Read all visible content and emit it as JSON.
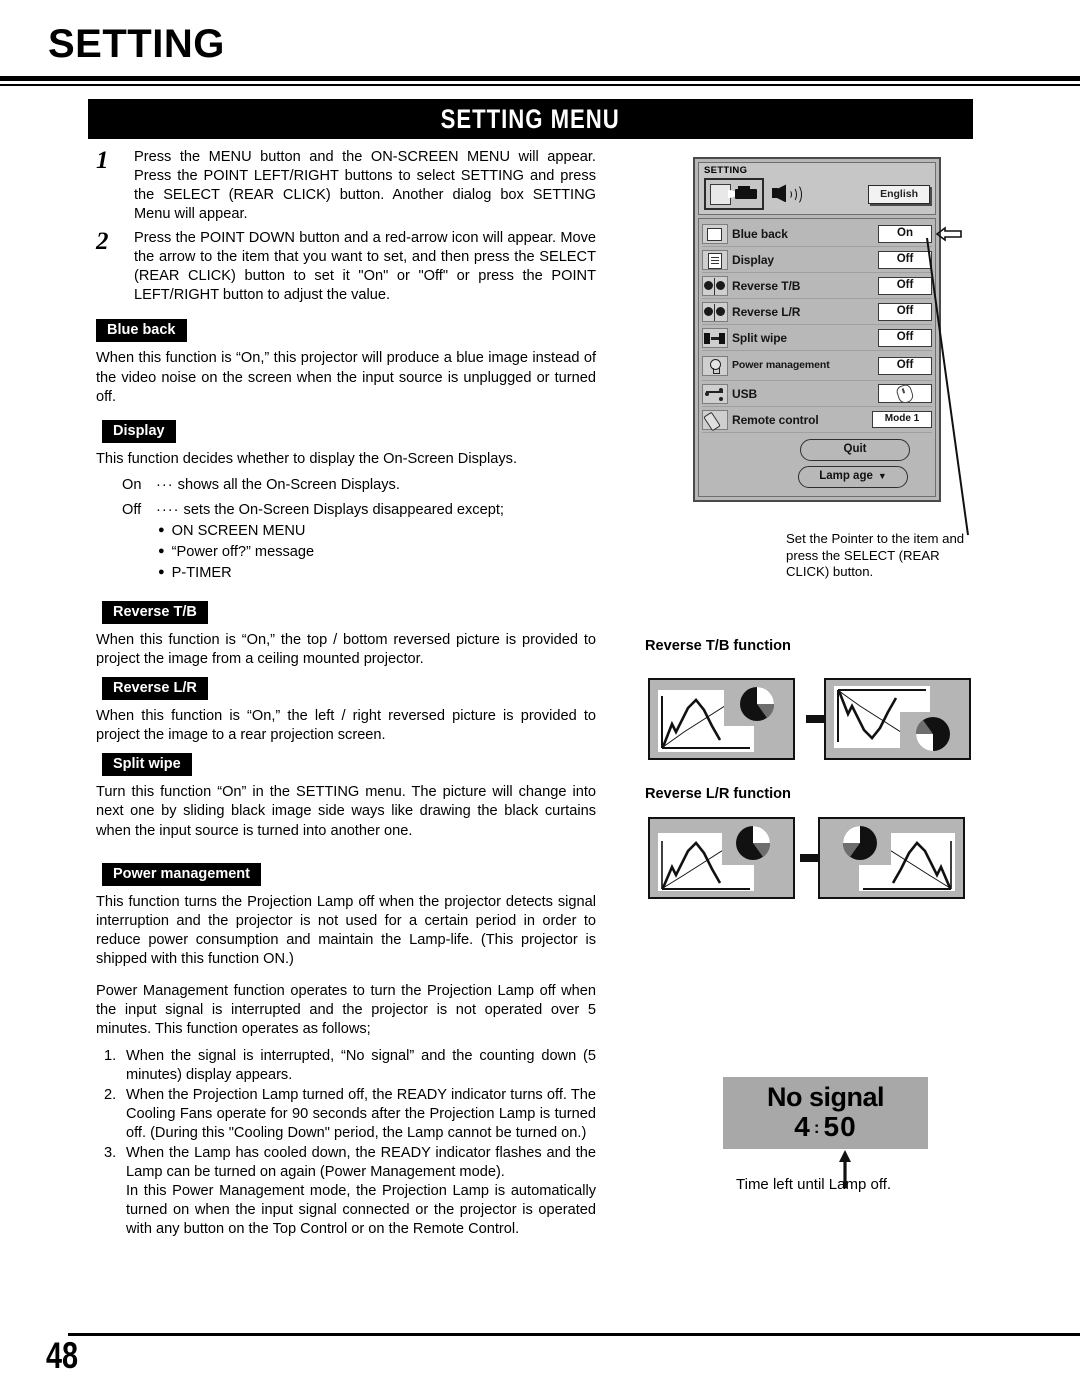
{
  "header": {
    "chapter_title": "SETTING",
    "banner_title": "SETTING MENU"
  },
  "steps": [
    {
      "number": "1",
      "text": "Press the MENU button and the ON-SCREEN MENU will appear.  Press the POINT LEFT/RIGHT buttons to select SETTING and press the SELECT (REAR CLICK) button. Another dialog box SETTING Menu will appear."
    },
    {
      "number": "2",
      "text": "Press the POINT DOWN button and a red-arrow icon will appear.  Move the arrow to the item that you want to set, and then press the SELECT (REAR CLICK) button to set it \"On\" or \"Off\" or press the POINT LEFT/RIGHT button to adjust the value."
    }
  ],
  "sections": {
    "blue_back": {
      "tag": "Blue back",
      "body": "When this function is “On,” this projector will produce a blue image instead of the video noise on the screen when the input source is unplugged or turned off."
    },
    "display": {
      "tag": "Display",
      "body": "This function decides whether to display the On-Screen Displays.",
      "on_label": "On",
      "on_dots": "···",
      "on_text": "shows all the On-Screen Displays.",
      "off_label": "Off",
      "off_dots": "····",
      "off_text": "sets the On-Screen Displays disappeared except;",
      "bullets": [
        "ON SCREEN MENU",
        "“Power off?” message",
        "P-TIMER"
      ]
    },
    "reverse_tb": {
      "tag": "Reverse T/B",
      "body": "When this function is “On,” the top / bottom reversed picture is provided to project the image from a ceiling mounted projector."
    },
    "reverse_lr": {
      "tag": "Reverse L/R",
      "body": "When this function is “On,” the left / right reversed picture is provided to project the image to a rear projection screen."
    },
    "split_wipe": {
      "tag": "Split wipe",
      "body": "Turn this function “On” in the SETTING menu.  The picture will change into next one by sliding black image side ways like drawing the black curtains when the input source is turned into another one."
    },
    "power_management": {
      "tag": "Power management",
      "para1": "This function turns the Projection Lamp off when the projector detects signal interruption and the projector is not used for a certain period in order to reduce power consumption and maintain the Lamp-life.  (This projector is shipped with this function ON.)",
      "para2": "Power Management function operates to turn the Projection Lamp off when the input signal is interrupted and the projector is not operated over 5 minutes.  This function operates as follows;",
      "items": [
        {
          "num": "1.",
          "text": "When the signal is interrupted, “No signal” and the counting down (5 minutes) display appears."
        },
        {
          "num": "2.",
          "text": "When the Projection Lamp turned off, the READY indicator turns off.  The Cooling Fans operate for 90 seconds after the Projection Lamp is turned off.  (During this \"Cooling Down\" period, the Lamp cannot be turned on.)"
        },
        {
          "num": "3.",
          "text": "When the Lamp has cooled down, the READY indicator flashes and the Lamp can be turned on again (Power Management mode).",
          "cont": "In this Power Management mode, the Projection Lamp is automatically turned on when the input signal connected or the projector is operated with any button on the Top Control or on the Remote Control."
        }
      ]
    }
  },
  "osd": {
    "title": "SETTING",
    "language_value": "English",
    "rows": [
      {
        "label": "Blue back",
        "value": "On",
        "icon": "blue-back-icon",
        "pointer": true
      },
      {
        "label": "Display",
        "value": "Off",
        "icon": "display-icon"
      },
      {
        "label": "Reverse T/B",
        "value": "Off",
        "icon": "reverse-tb-icon"
      },
      {
        "label": "Reverse L/R",
        "value": "Off",
        "icon": "reverse-lr-icon"
      },
      {
        "label": "Split wipe",
        "value": "Off",
        "icon": "split-wipe-icon"
      },
      {
        "label": "Power management",
        "value": "Off",
        "icon": "power-management-icon"
      },
      {
        "label": "USB",
        "value": "",
        "icon": "usb-icon"
      },
      {
        "label": "Remote control",
        "value": "Mode 1",
        "icon": "remote-control-icon"
      }
    ],
    "quit_label": "Quit",
    "lamp_age_label": "Lamp age",
    "caption": "Set the Pointer to the item and press the SELECT (REAR CLICK) button."
  },
  "figures": {
    "reverse_tb_title": "Reverse T/B function",
    "reverse_lr_title": "Reverse L/R function"
  },
  "no_signal": {
    "line1": "No signal",
    "minutes": "4",
    "colon": ":",
    "seconds": "50",
    "caption": "Time left until Lamp off."
  },
  "footer": {
    "page_number": "48"
  }
}
